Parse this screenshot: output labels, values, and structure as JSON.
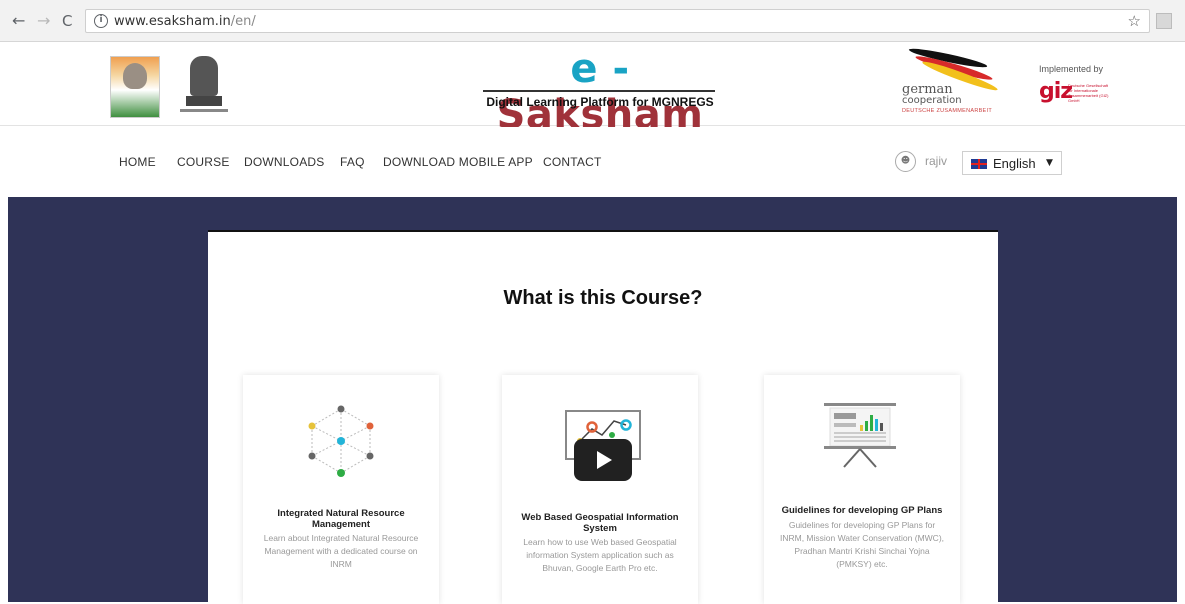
{
  "browser": {
    "url_host": "www.esaksham.in",
    "url_path": "/en/",
    "back": "←",
    "forward": "→",
    "reload": "C",
    "star": "☆",
    "info": "i"
  },
  "header": {
    "brand_e": "e - ",
    "brand_saksham": "Saksham",
    "subtitle": "Digital Learning Platform for MGNREGS",
    "german_line1": "german",
    "german_line2": "cooperation",
    "german_line3": "DEUTSCHE ZUSAMMENARBEIT",
    "implemented_by": "Implemented by",
    "giz": "giz",
    "giz_small": "Deutsche Gesellschaft für Internationale Zusammenarbeit (GIZ) GmbH"
  },
  "menu": {
    "items": [
      "HOME",
      "COURSE",
      "DOWNLOADS",
      "FAQ",
      "DOWNLOAD MOBILE APP",
      "CONTACT"
    ],
    "user": "rajiv",
    "language": "English"
  },
  "content": {
    "title": "What is this Course?",
    "cards": [
      {
        "title": "Integrated Natural Resource Management",
        "description": "Learn about Integrated Natural Resource Management with a dedicated course on INRM"
      },
      {
        "title": "Web Based Geospatial Information System",
        "description": "Learn how to use Web based Geospatial information System application such as Bhuvan, Google Earth Pro etc."
      },
      {
        "title": "Guidelines for developing GP Plans",
        "description": "Guidelines for developing GP Plans for INRM, Mission Water Conservation (MWC), Pradhan Mantri Krishi Sinchai Yojna (PMKSY) etc."
      }
    ]
  },
  "colors": {
    "hero_bg": "#2f3357",
    "brand_blue": "#19a3c4",
    "brand_red": "#a0323a",
    "giz_red": "#c8102e"
  },
  "icons": [
    "back-arrow-icon",
    "forward-arrow-icon",
    "reload-icon",
    "info-icon",
    "star-icon",
    "user-icon",
    "uk-flag-icon",
    "caret-down-icon",
    "play-icon"
  ]
}
